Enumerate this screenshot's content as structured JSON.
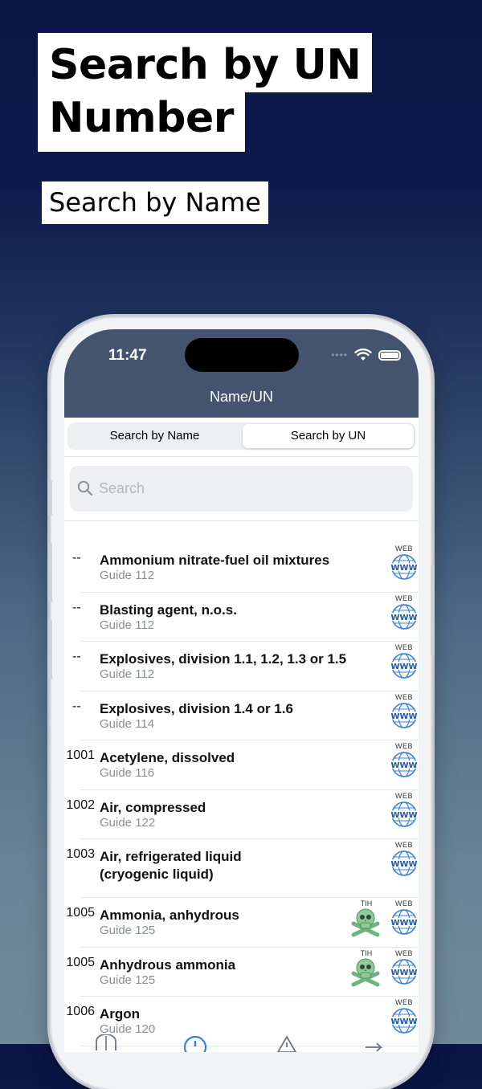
{
  "promo": {
    "title_line1": "Search by UN",
    "title_line2": "Number",
    "subtitle": "Search by Name"
  },
  "status": {
    "time": "11:47"
  },
  "nav": {
    "title": "Name/UN"
  },
  "segment": {
    "left": "Search by Name",
    "right": "Search by UN",
    "selected": "Search by UN"
  },
  "search": {
    "placeholder": "Search"
  },
  "badges": {
    "web": "WEB",
    "tih": "TIH"
  },
  "items": [
    {
      "un": "--",
      "name": "Ammonium nitrate-fuel oil mixtures",
      "guide": "Guide  112",
      "tih": false
    },
    {
      "un": "--",
      "name": "Blasting agent, n.o.s.",
      "guide": "Guide  112",
      "tih": false
    },
    {
      "un": "--",
      "name": "Explosives, division 1.1, 1.2, 1.3 or 1.5",
      "guide": "Guide  112",
      "tih": false
    },
    {
      "un": "--",
      "name": "Explosives, division 1.4 or 1.6",
      "guide": "Guide  114",
      "tih": false
    },
    {
      "un": "1001",
      "name": "Acetylene, dissolved",
      "guide": "Guide  116",
      "tih": false
    },
    {
      "un": "1002",
      "name": "Air, compressed",
      "guide": "Guide  122",
      "tih": false
    },
    {
      "un": "1003",
      "name": "Air, refrigerated liquid (cryogenic liquid)",
      "name_line1": "Air, refrigerated liquid",
      "name_line2": "(cryogenic liquid)",
      "guide": "",
      "tih": false
    },
    {
      "un": "1005",
      "name": "Ammonia, anhydrous",
      "guide": "Guide  125",
      "tih": true
    },
    {
      "un": "1005",
      "name": "Anhydrous ammonia",
      "guide": "Guide  125",
      "tih": true
    },
    {
      "un": "1006",
      "name": "Argon",
      "guide": "Guide  120",
      "tih": false
    }
  ],
  "colors": {
    "header": "#45546e",
    "accent": "#3b7fd8",
    "tih_green": "#7cc08a"
  }
}
